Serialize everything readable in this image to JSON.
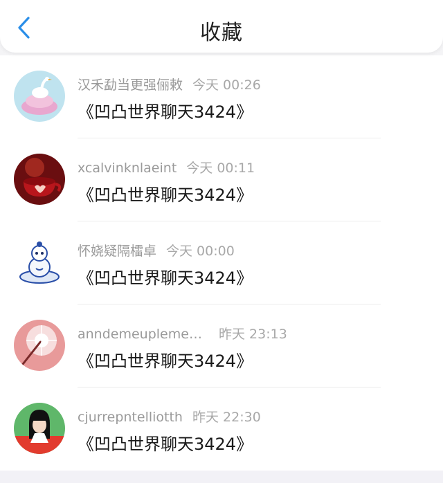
{
  "header": {
    "title": "收藏",
    "back_icon": "chevron-left-icon",
    "accent_color": "#2a8ee8"
  },
  "items": [
    {
      "name": "汉禾勐当更强俪敕",
      "time": "今天 00:26",
      "message": "《凹凸世界聊天3424》",
      "avatar": "swan-avatar"
    },
    {
      "name": "xcalvinknlaeint",
      "time": "今天 00:11",
      "message": "《凹凸世界聊天3424》",
      "avatar": "teacup-avatar"
    },
    {
      "name": "怀娆疑隔檑卓",
      "time": "今天 00:00",
      "message": "《凹凸世界聊天3424》",
      "avatar": "porcelain-figure-avatar"
    },
    {
      "name": "anndemeupleme…",
      "time": "昨天 23:13",
      "message": "《凹凸世界聊天3424》",
      "avatar": "sparkle-avatar"
    },
    {
      "name": "cjurrepntelliotth",
      "time": "昨天 22:30",
      "message": "《凹凸世界聊天3424》",
      "avatar": "girl-avatar"
    }
  ]
}
